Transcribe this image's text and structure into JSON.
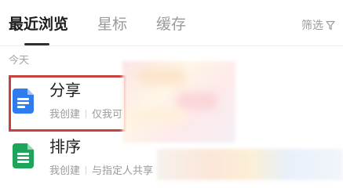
{
  "tabs": {
    "recent": "最近浏览",
    "starred": "星标",
    "cached": "缓存"
  },
  "filter": {
    "label": "筛选",
    "icon": "filter-funnel-icon"
  },
  "section": {
    "today": "今天"
  },
  "files": [
    {
      "title": "分享",
      "owner": "我创建",
      "permission": "仅我可",
      "icon": "doc-icon",
      "icon_color": "#2f7bf0",
      "highlighted": true,
      "highlight_color": "#c9413d"
    },
    {
      "title": "排序",
      "owner": "我创建",
      "permission": "与指定人共享",
      "icon": "sheet-icon",
      "icon_color": "#1ca55b",
      "highlighted": false
    }
  ]
}
